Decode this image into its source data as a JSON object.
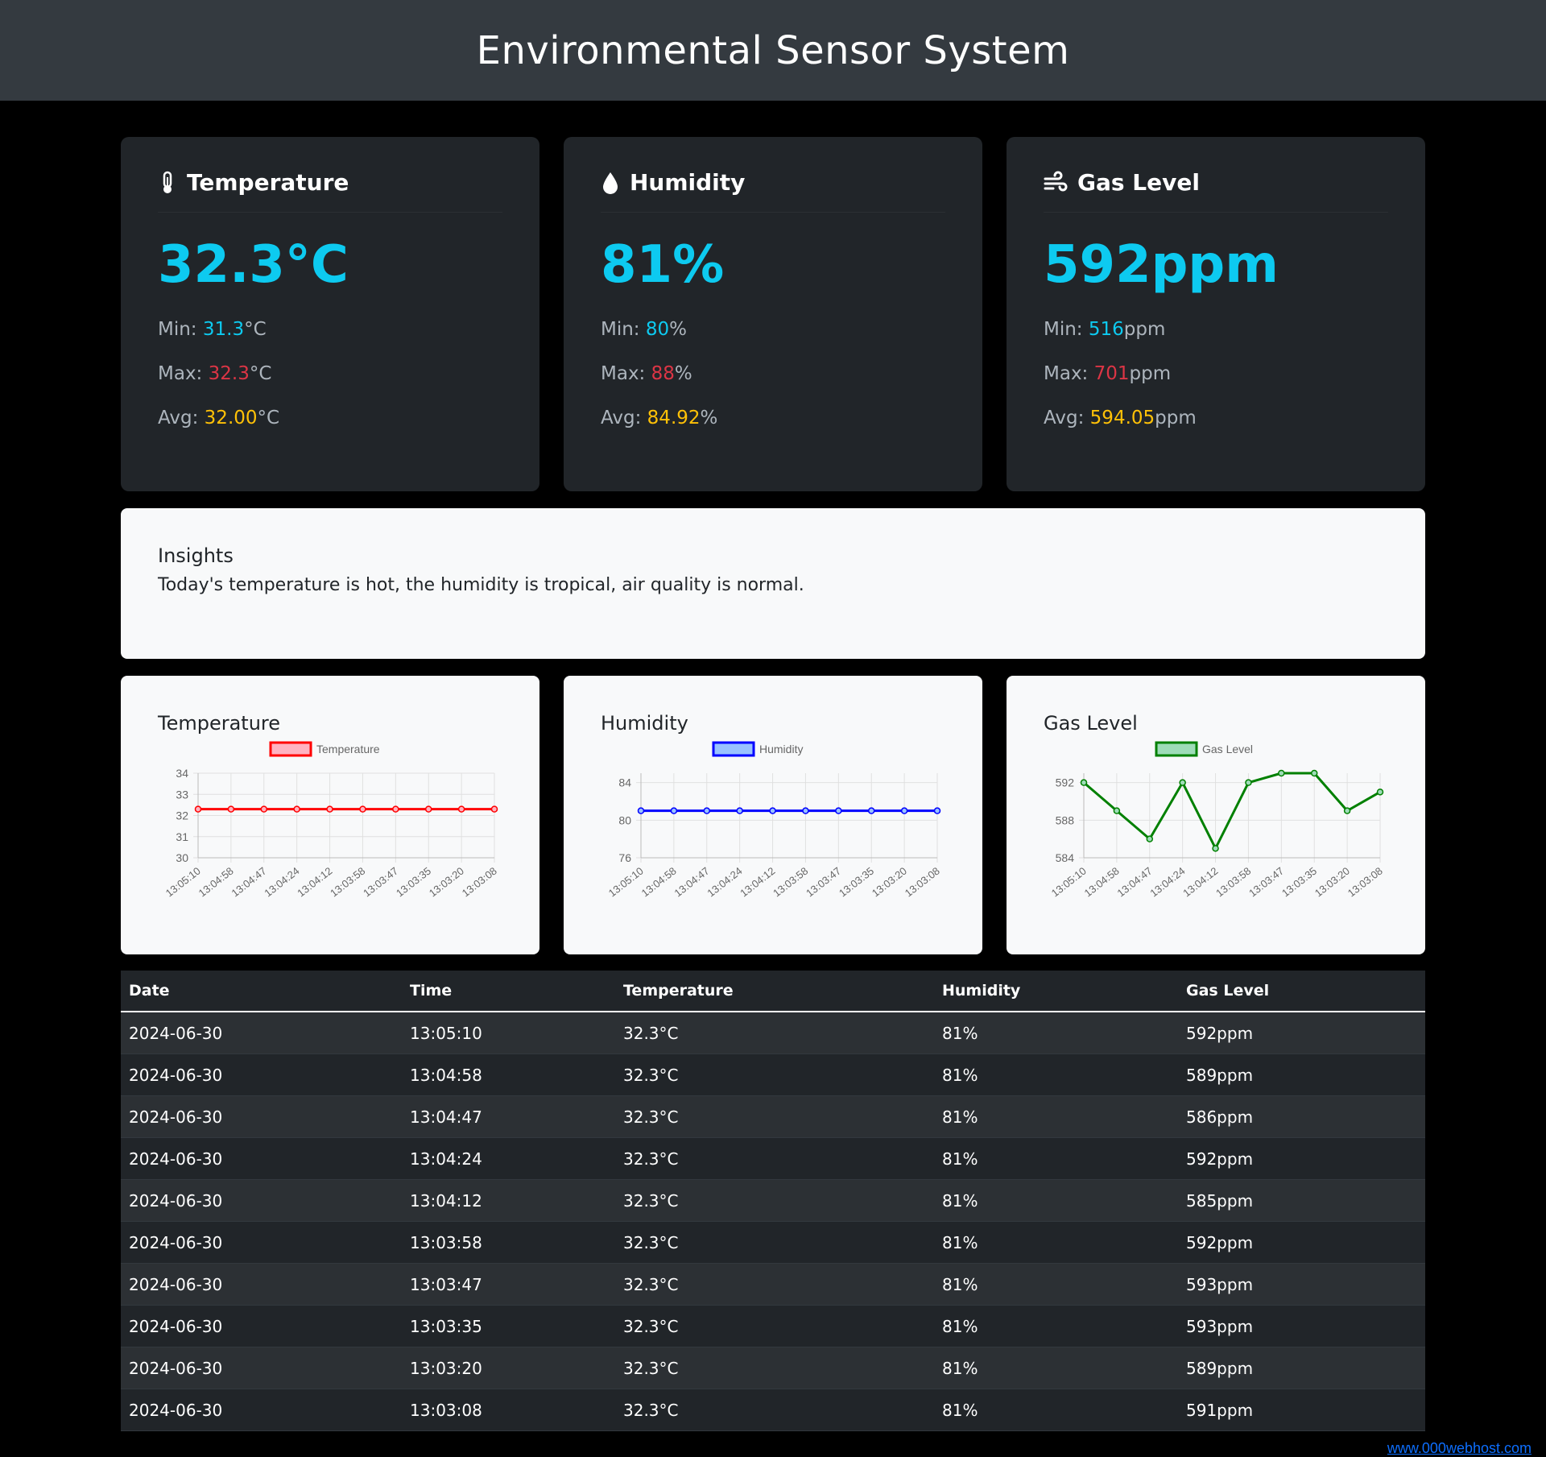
{
  "header": {
    "title": "Environmental Sensor System"
  },
  "cards": [
    {
      "title": "Temperature",
      "icon": "thermometer-icon",
      "value": "32.3°C",
      "min_label": "Min: ",
      "min": "31.3",
      "max_label": "Max: ",
      "max": "32.3",
      "avg_label": "Avg: ",
      "avg": "32.00",
      "unit": "°C"
    },
    {
      "title": "Humidity",
      "icon": "droplet-icon",
      "value": "81%",
      "min_label": "Min: ",
      "min": "80",
      "max_label": "Max: ",
      "max": "88",
      "avg_label": "Avg: ",
      "avg": "84.92",
      "unit": "%"
    },
    {
      "title": "Gas Level",
      "icon": "wind-icon",
      "value": "592ppm",
      "min_label": "Min: ",
      "min": "516",
      "max_label": "Max: ",
      "max": "701",
      "avg_label": "Avg: ",
      "avg": "594.05",
      "unit": "ppm"
    }
  ],
  "insights": {
    "title": "Insights",
    "text": "Today's temperature is hot, the humidity is tropical, air quality is normal."
  },
  "charts": {
    "titles": [
      "Temperature",
      "Humidity",
      "Gas Level"
    ]
  },
  "chart_data": [
    {
      "type": "line",
      "title": "Temperature",
      "x": [
        "13:05:10",
        "13:04:58",
        "13:04:47",
        "13:04:24",
        "13:04:12",
        "13:03:58",
        "13:03:47",
        "13:03:35",
        "13:03:20",
        "13:03:08"
      ],
      "series": [
        {
          "name": "Temperature",
          "values": [
            32.3,
            32.3,
            32.3,
            32.3,
            32.3,
            32.3,
            32.3,
            32.3,
            32.3,
            32.3
          ],
          "color": "#ff0000",
          "fill": "#ffb3c1"
        }
      ],
      "ylim": [
        30,
        34
      ],
      "yticks": [
        30,
        31,
        32,
        33,
        34
      ],
      "legend": "top"
    },
    {
      "type": "line",
      "title": "Humidity",
      "x": [
        "13:05:10",
        "13:04:58",
        "13:04:47",
        "13:04:24",
        "13:04:12",
        "13:03:58",
        "13:03:47",
        "13:03:35",
        "13:03:20",
        "13:03:08"
      ],
      "series": [
        {
          "name": "Humidity",
          "values": [
            81,
            81,
            81,
            81,
            81,
            81,
            81,
            81,
            81,
            81
          ],
          "color": "#0000ff",
          "fill": "#99c2ff"
        }
      ],
      "ylim": [
        76,
        85
      ],
      "yticks": [
        76,
        80,
        84
      ],
      "legend": "top"
    },
    {
      "type": "line",
      "title": "Gas Level",
      "x": [
        "13:05:10",
        "13:04:58",
        "13:04:47",
        "13:04:24",
        "13:04:12",
        "13:03:58",
        "13:03:47",
        "13:03:35",
        "13:03:20",
        "13:03:08"
      ],
      "series": [
        {
          "name": "Gas Level",
          "values": [
            592,
            589,
            586,
            592,
            585,
            592,
            593,
            593,
            589,
            591
          ],
          "color": "#008000",
          "fill": "#9edcb8"
        }
      ],
      "ylim": [
        584,
        593
      ],
      "yticks": [
        584,
        588,
        592
      ],
      "legend": "top"
    }
  ],
  "table": {
    "headers": [
      "Date",
      "Time",
      "Temperature",
      "Humidity",
      "Gas Level"
    ],
    "rows": [
      [
        "2024-06-30",
        "13:05:10",
        "32.3°C",
        "81%",
        "592ppm"
      ],
      [
        "2024-06-30",
        "13:04:58",
        "32.3°C",
        "81%",
        "589ppm"
      ],
      [
        "2024-06-30",
        "13:04:47",
        "32.3°C",
        "81%",
        "586ppm"
      ],
      [
        "2024-06-30",
        "13:04:24",
        "32.3°C",
        "81%",
        "592ppm"
      ],
      [
        "2024-06-30",
        "13:04:12",
        "32.3°C",
        "81%",
        "585ppm"
      ],
      [
        "2024-06-30",
        "13:03:58",
        "32.3°C",
        "81%",
        "592ppm"
      ],
      [
        "2024-06-30",
        "13:03:47",
        "32.3°C",
        "81%",
        "593ppm"
      ],
      [
        "2024-06-30",
        "13:03:35",
        "32.3°C",
        "81%",
        "593ppm"
      ],
      [
        "2024-06-30",
        "13:03:20",
        "32.3°C",
        "81%",
        "589ppm"
      ],
      [
        "2024-06-30",
        "13:03:08",
        "32.3°C",
        "81%",
        "591ppm"
      ]
    ]
  },
  "footer": {
    "link": "www.000webhost.com"
  }
}
